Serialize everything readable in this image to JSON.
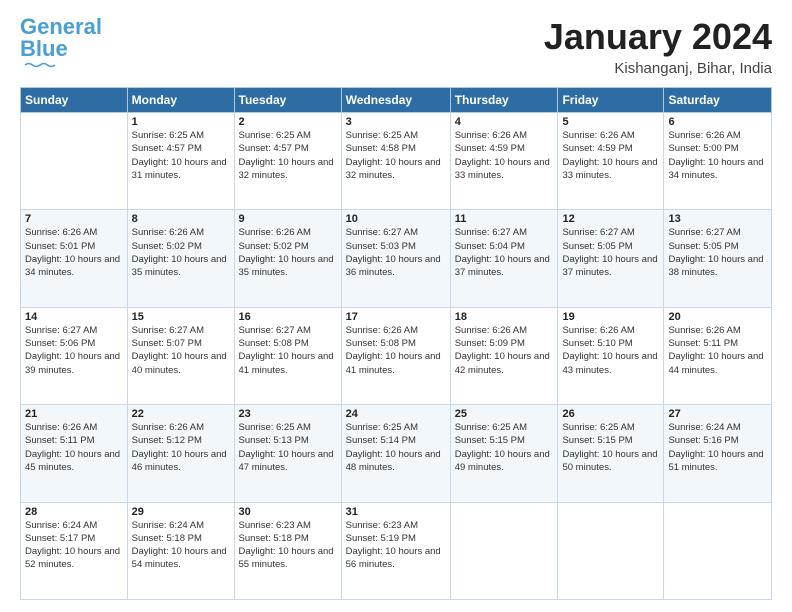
{
  "logo": {
    "part1": "General",
    "part2": "Blue"
  },
  "header": {
    "month": "January 2024",
    "location": "Kishanganj, Bihar, India"
  },
  "weekdays": [
    "Sunday",
    "Monday",
    "Tuesday",
    "Wednesday",
    "Thursday",
    "Friday",
    "Saturday"
  ],
  "weeks": [
    [
      {
        "day": "",
        "sunrise": "",
        "sunset": "",
        "daylight": ""
      },
      {
        "day": "1",
        "sunrise": "Sunrise: 6:25 AM",
        "sunset": "Sunset: 4:57 PM",
        "daylight": "Daylight: 10 hours and 31 minutes."
      },
      {
        "day": "2",
        "sunrise": "Sunrise: 6:25 AM",
        "sunset": "Sunset: 4:57 PM",
        "daylight": "Daylight: 10 hours and 32 minutes."
      },
      {
        "day": "3",
        "sunrise": "Sunrise: 6:25 AM",
        "sunset": "Sunset: 4:58 PM",
        "daylight": "Daylight: 10 hours and 32 minutes."
      },
      {
        "day": "4",
        "sunrise": "Sunrise: 6:26 AM",
        "sunset": "Sunset: 4:59 PM",
        "daylight": "Daylight: 10 hours and 33 minutes."
      },
      {
        "day": "5",
        "sunrise": "Sunrise: 6:26 AM",
        "sunset": "Sunset: 4:59 PM",
        "daylight": "Daylight: 10 hours and 33 minutes."
      },
      {
        "day": "6",
        "sunrise": "Sunrise: 6:26 AM",
        "sunset": "Sunset: 5:00 PM",
        "daylight": "Daylight: 10 hours and 34 minutes."
      }
    ],
    [
      {
        "day": "7",
        "sunrise": "Sunrise: 6:26 AM",
        "sunset": "Sunset: 5:01 PM",
        "daylight": "Daylight: 10 hours and 34 minutes."
      },
      {
        "day": "8",
        "sunrise": "Sunrise: 6:26 AM",
        "sunset": "Sunset: 5:02 PM",
        "daylight": "Daylight: 10 hours and 35 minutes."
      },
      {
        "day": "9",
        "sunrise": "Sunrise: 6:26 AM",
        "sunset": "Sunset: 5:02 PM",
        "daylight": "Daylight: 10 hours and 35 minutes."
      },
      {
        "day": "10",
        "sunrise": "Sunrise: 6:27 AM",
        "sunset": "Sunset: 5:03 PM",
        "daylight": "Daylight: 10 hours and 36 minutes."
      },
      {
        "day": "11",
        "sunrise": "Sunrise: 6:27 AM",
        "sunset": "Sunset: 5:04 PM",
        "daylight": "Daylight: 10 hours and 37 minutes."
      },
      {
        "day": "12",
        "sunrise": "Sunrise: 6:27 AM",
        "sunset": "Sunset: 5:05 PM",
        "daylight": "Daylight: 10 hours and 37 minutes."
      },
      {
        "day": "13",
        "sunrise": "Sunrise: 6:27 AM",
        "sunset": "Sunset: 5:05 PM",
        "daylight": "Daylight: 10 hours and 38 minutes."
      }
    ],
    [
      {
        "day": "14",
        "sunrise": "Sunrise: 6:27 AM",
        "sunset": "Sunset: 5:06 PM",
        "daylight": "Daylight: 10 hours and 39 minutes."
      },
      {
        "day": "15",
        "sunrise": "Sunrise: 6:27 AM",
        "sunset": "Sunset: 5:07 PM",
        "daylight": "Daylight: 10 hours and 40 minutes."
      },
      {
        "day": "16",
        "sunrise": "Sunrise: 6:27 AM",
        "sunset": "Sunset: 5:08 PM",
        "daylight": "Daylight: 10 hours and 41 minutes."
      },
      {
        "day": "17",
        "sunrise": "Sunrise: 6:26 AM",
        "sunset": "Sunset: 5:08 PM",
        "daylight": "Daylight: 10 hours and 41 minutes."
      },
      {
        "day": "18",
        "sunrise": "Sunrise: 6:26 AM",
        "sunset": "Sunset: 5:09 PM",
        "daylight": "Daylight: 10 hours and 42 minutes."
      },
      {
        "day": "19",
        "sunrise": "Sunrise: 6:26 AM",
        "sunset": "Sunset: 5:10 PM",
        "daylight": "Daylight: 10 hours and 43 minutes."
      },
      {
        "day": "20",
        "sunrise": "Sunrise: 6:26 AM",
        "sunset": "Sunset: 5:11 PM",
        "daylight": "Daylight: 10 hours and 44 minutes."
      }
    ],
    [
      {
        "day": "21",
        "sunrise": "Sunrise: 6:26 AM",
        "sunset": "Sunset: 5:11 PM",
        "daylight": "Daylight: 10 hours and 45 minutes."
      },
      {
        "day": "22",
        "sunrise": "Sunrise: 6:26 AM",
        "sunset": "Sunset: 5:12 PM",
        "daylight": "Daylight: 10 hours and 46 minutes."
      },
      {
        "day": "23",
        "sunrise": "Sunrise: 6:25 AM",
        "sunset": "Sunset: 5:13 PM",
        "daylight": "Daylight: 10 hours and 47 minutes."
      },
      {
        "day": "24",
        "sunrise": "Sunrise: 6:25 AM",
        "sunset": "Sunset: 5:14 PM",
        "daylight": "Daylight: 10 hours and 48 minutes."
      },
      {
        "day": "25",
        "sunrise": "Sunrise: 6:25 AM",
        "sunset": "Sunset: 5:15 PM",
        "daylight": "Daylight: 10 hours and 49 minutes."
      },
      {
        "day": "26",
        "sunrise": "Sunrise: 6:25 AM",
        "sunset": "Sunset: 5:15 PM",
        "daylight": "Daylight: 10 hours and 50 minutes."
      },
      {
        "day": "27",
        "sunrise": "Sunrise: 6:24 AM",
        "sunset": "Sunset: 5:16 PM",
        "daylight": "Daylight: 10 hours and 51 minutes."
      }
    ],
    [
      {
        "day": "28",
        "sunrise": "Sunrise: 6:24 AM",
        "sunset": "Sunset: 5:17 PM",
        "daylight": "Daylight: 10 hours and 52 minutes."
      },
      {
        "day": "29",
        "sunrise": "Sunrise: 6:24 AM",
        "sunset": "Sunset: 5:18 PM",
        "daylight": "Daylight: 10 hours and 54 minutes."
      },
      {
        "day": "30",
        "sunrise": "Sunrise: 6:23 AM",
        "sunset": "Sunset: 5:18 PM",
        "daylight": "Daylight: 10 hours and 55 minutes."
      },
      {
        "day": "31",
        "sunrise": "Sunrise: 6:23 AM",
        "sunset": "Sunset: 5:19 PM",
        "daylight": "Daylight: 10 hours and 56 minutes."
      },
      {
        "day": "",
        "sunrise": "",
        "sunset": "",
        "daylight": ""
      },
      {
        "day": "",
        "sunrise": "",
        "sunset": "",
        "daylight": ""
      },
      {
        "day": "",
        "sunrise": "",
        "sunset": "",
        "daylight": ""
      }
    ]
  ]
}
